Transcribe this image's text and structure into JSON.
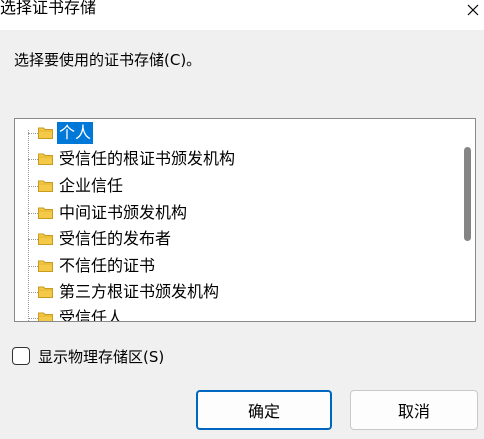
{
  "window": {
    "title": "选择证书存储"
  },
  "prompt": "选择要使用的证书存储(C)。",
  "tree": {
    "items": [
      {
        "label": "个人",
        "selected": true
      },
      {
        "label": "受信任的根证书颁发机构",
        "selected": false
      },
      {
        "label": "企业信任",
        "selected": false
      },
      {
        "label": "中间证书颁发机构",
        "selected": false
      },
      {
        "label": "受信任的发布者",
        "selected": false
      },
      {
        "label": "不信任的证书",
        "selected": false
      },
      {
        "label": "第三方根证书颁发机构",
        "selected": false
      },
      {
        "label": "受信任人",
        "selected": false
      }
    ]
  },
  "checkbox": {
    "label": "显示物理存储区(S)",
    "checked": false
  },
  "buttons": {
    "ok": "确定",
    "cancel": "取消"
  },
  "colors": {
    "selection": "#0078d7",
    "folder": "#f4c948",
    "primary_border": "#0067c0"
  }
}
